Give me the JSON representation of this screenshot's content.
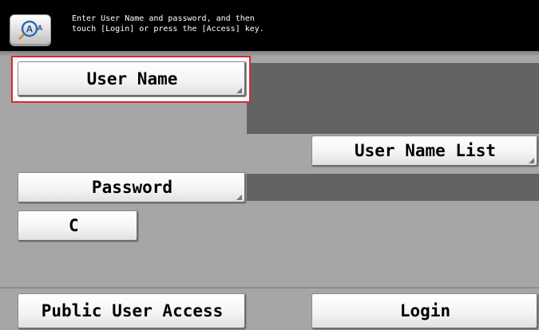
{
  "header": {
    "icon": "accessibility-icon",
    "message_line1": "Enter User Name and password, and then",
    "message_line2": "touch [Login] or press the [Access] key."
  },
  "form": {
    "user_name_label": "User Name",
    "user_name_value": "",
    "user_name_list_label": "User Name List",
    "password_label": "Password",
    "password_value": "",
    "clear_label": "C"
  },
  "footer": {
    "public_access_label": "Public User Access",
    "login_label": "Login"
  },
  "colors": {
    "selection_border": "#d8292f",
    "field_background": "#626463",
    "panel_background": "#a6a6a6"
  }
}
